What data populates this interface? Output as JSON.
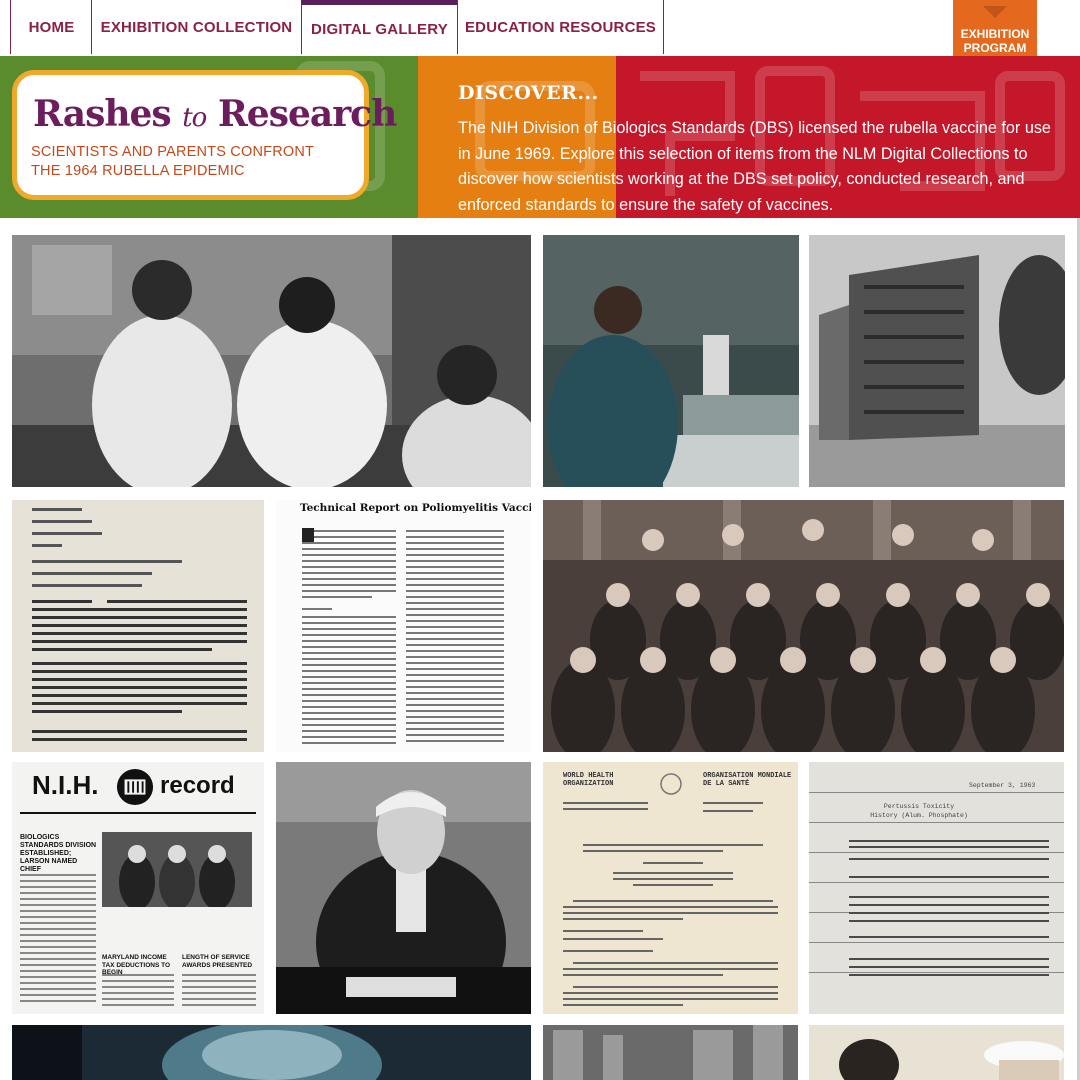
{
  "nav": {
    "items": [
      {
        "label": "HOME"
      },
      {
        "label": "EXHIBITION COLLECTION"
      },
      {
        "label": "DIGITAL GALLERY"
      },
      {
        "label": "EDUCATION RESOURCES"
      }
    ],
    "active_index": 2,
    "exhibition_badge": {
      "line1": "EXHIBITION",
      "line2": "PROGRAM"
    }
  },
  "banner": {
    "logo": {
      "title_part1": "Rashes",
      "title_part2": "to",
      "title_part3": "Research",
      "subtitle": "SCIENTISTS AND PARENTS CONFRONT THE 1964 RUBELLA EPIDEMIC"
    },
    "discover": {
      "heading": "DISCOVER...",
      "text": "The NIH Division of Biologics Standards (DBS) licensed the rubella vaccine for use in June 1969. Explore this selection of items from the NLM Digital Collections to discover how scientists working at the DBS set policy, conducted research, and enforced standards to ensure the safety of vaccines."
    }
  },
  "gallery": {
    "report_title": "Technical Report on Poliomyelitis Vaccine",
    "nih_record_masthead_left": "N.I.H.",
    "nih_record_masthead_right": "record",
    "nih_record_headline": "BIOLOGICS STANDARDS DIVISION ESTABLISHED; LARSON NAMED CHIEF",
    "nih_record_sub1": "MARYLAND INCOME TAX DEDUCTIONS TO BEGIN",
    "nih_record_sub2": "LENGTH OF SERVICE AWARDS PRESENTED",
    "who_left": "WORLD HEALTH ORGANIZATION",
    "who_right": "ORGANISATION MONDIALE DE LA SANTÉ",
    "toxicity_date": "September 3, 1963",
    "toxicity_title": "Pertussis Toxicity History (Alum. Phosphate)"
  },
  "colors": {
    "nav_text": "#8a2243",
    "banner_green": "#5a8b2c",
    "banner_orange": "#e57f12",
    "banner_red": "#c4182a",
    "logo_border": "#f0a92a",
    "logo_title": "#6c1d5e",
    "exhibition_badge": "#e4691e"
  }
}
